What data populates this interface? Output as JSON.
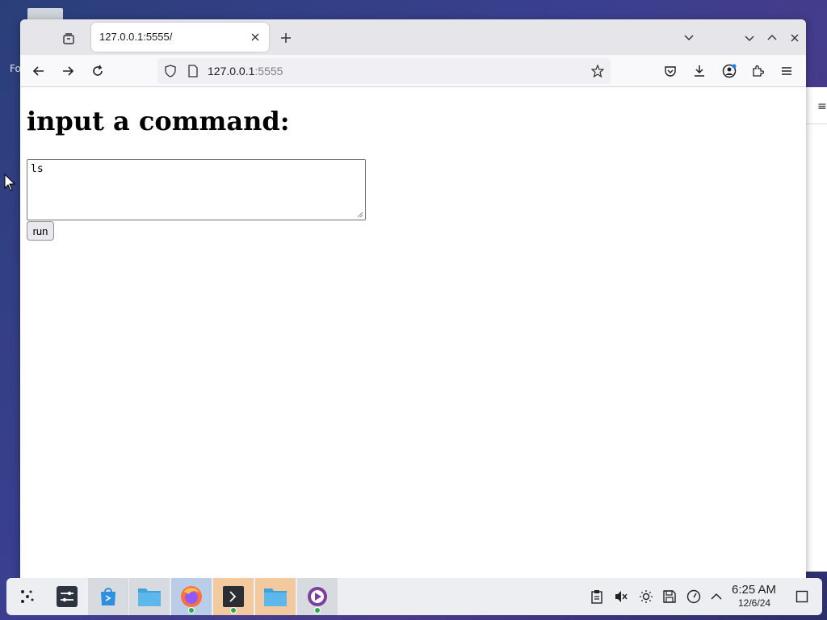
{
  "desktop": {
    "partial_label": "Fo"
  },
  "browser": {
    "tab": {
      "title": "127.0.0.1:5555/"
    },
    "url": {
      "host": "127.0.0.1",
      "port": ":5555"
    }
  },
  "page": {
    "heading": "input a command:",
    "textarea_value": "ls",
    "run_label": "run"
  },
  "taskbar": {
    "apps": [
      {
        "name": "system-settings",
        "state": "normal"
      },
      {
        "name": "discover-store",
        "state": "highlight"
      },
      {
        "name": "file-manager",
        "state": "highlight"
      },
      {
        "name": "firefox",
        "state": "active"
      },
      {
        "name": "terminal",
        "state": "running"
      },
      {
        "name": "file-manager-2",
        "state": "running"
      },
      {
        "name": "media-player",
        "state": "highlight"
      }
    ],
    "clock": {
      "time": "6:25 AM",
      "date": "12/6/24"
    }
  },
  "colors": {
    "accent": "#0a84ff",
    "taskbar_bg": "#eceef1",
    "active_app": "#b9cde8",
    "running_app": "#f3c9a0"
  }
}
